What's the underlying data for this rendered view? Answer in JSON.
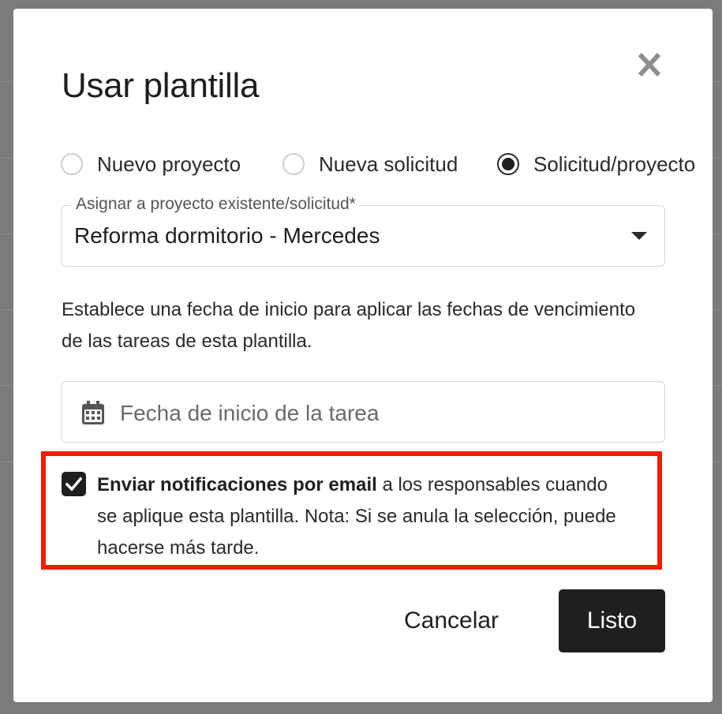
{
  "dialog": {
    "title": "Usar plantilla",
    "close_icon": "close-icon"
  },
  "type_options": [
    {
      "label": "Nuevo proyecto",
      "checked": false
    },
    {
      "label": "Nueva solicitud",
      "checked": false
    },
    {
      "label": "Solicitud/proyecto",
      "checked": true
    }
  ],
  "assign": {
    "label": "Asignar a proyecto existente/solicitud*",
    "value": "Reforma dormitorio - Mercedes",
    "arrow_icon": "caret-down-icon"
  },
  "helper_text": "Establece una fecha de inicio para aplicar las fechas de vencimiento de las tareas de esta plantilla.",
  "start_date": {
    "placeholder": "Fecha de inicio de la tarea",
    "icon": "calendar-icon"
  },
  "notifications": {
    "checked": true,
    "bold_text": "Enviar notificaciones por email",
    "rest_text": " a los responsables cuando se aplique esta plantilla. Nota: Si se anula la selección, puede hacerse más tarde.",
    "highlight_color": "#f31c00"
  },
  "actions": {
    "cancel_label": "Cancelar",
    "done_label": "Listo"
  },
  "colors": {
    "primary": "#1f1f1f",
    "overlay": "#7b7b7b"
  }
}
